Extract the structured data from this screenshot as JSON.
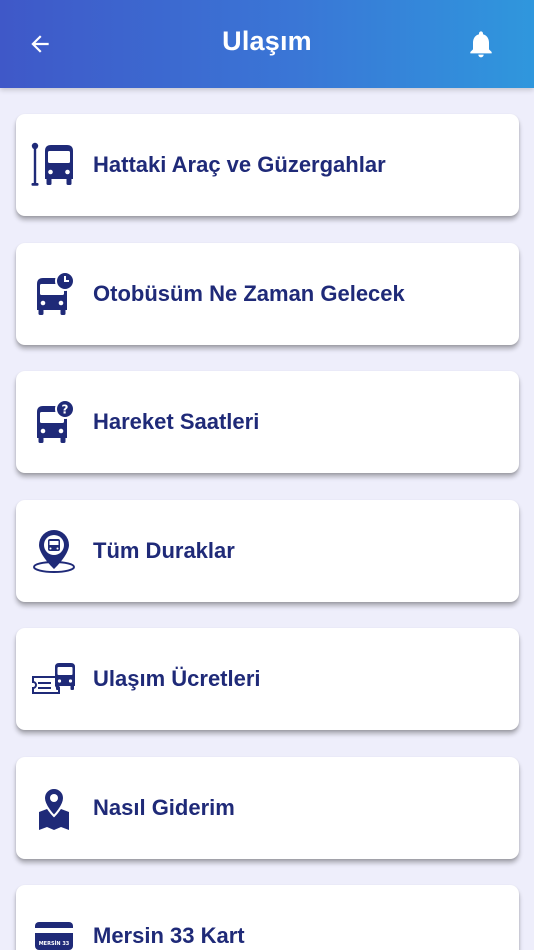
{
  "header": {
    "title": "Ulaşım",
    "back_icon": "arrow-left-icon",
    "notification_icon": "bell-icon"
  },
  "colors": {
    "header_gradient_start": "#3f58c8",
    "header_gradient_end": "#2f97dd",
    "background": "#eeeefb",
    "card_text": "#1f2a78",
    "icon_color": "#1f2a78"
  },
  "menu": {
    "items": [
      {
        "label": "Hattaki Araç ve Güzergahlar",
        "icon": "bus-stop-icon"
      },
      {
        "label": "Otobüsüm Ne Zaman Gelecek",
        "icon": "bus-clock-icon"
      },
      {
        "label": "Hareket Saatleri",
        "icon": "bus-question-icon"
      },
      {
        "label": "Tüm Duraklar",
        "icon": "bus-location-icon"
      },
      {
        "label": "Ulaşım Ücretleri",
        "icon": "bus-ticket-icon"
      },
      {
        "label": "Nasıl Giderim",
        "icon": "map-pin-icon"
      },
      {
        "label": "Mersin 33 Kart",
        "icon": "card-icon"
      }
    ]
  },
  "card_caption": "MERSİN 33"
}
